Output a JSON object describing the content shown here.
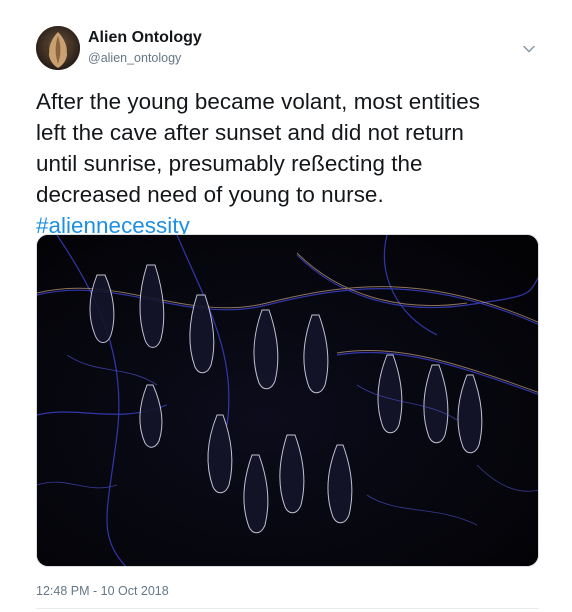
{
  "author": {
    "display_name": "Alien Ontology",
    "handle": "@alien_ontology"
  },
  "tweet": {
    "text_lines": [
      "After the young became volant, most entities",
      "left the cave after sunset and did not return",
      "until sunrise, presumably reßecting the",
      "decreased need of young to nurse."
    ],
    "hashtag": "#aliennecessity",
    "timestamp": "12:48 PM - 10 Oct 2018"
  },
  "icons": {
    "menu": "chevron-down-icon",
    "avatar": "bat-avatar"
  },
  "colors": {
    "text": "#14171a",
    "secondary": "#657786",
    "link": "#1d8fe0",
    "media_background": "#050508",
    "media_edges": "#4b4fd6"
  }
}
